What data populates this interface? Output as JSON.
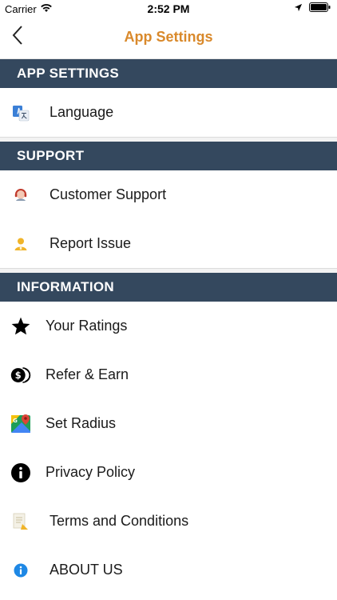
{
  "status_bar": {
    "carrier": "Carrier",
    "time": "2:52 PM"
  },
  "nav": {
    "title": "App Settings",
    "title_color": "#d9892b"
  },
  "sections": [
    {
      "header": "APP SETTINGS",
      "items": [
        {
          "label": "Language",
          "icon": "translate-icon"
        }
      ]
    },
    {
      "header": "SUPPORT",
      "items": [
        {
          "label": "Customer Support",
          "icon": "support-agent-icon"
        },
        {
          "label": "Report Issue",
          "icon": "report-person-icon"
        }
      ]
    },
    {
      "header": "INFORMATION",
      "items": [
        {
          "label": "Your Ratings",
          "icon": "star-icon"
        },
        {
          "label": "Refer & Earn",
          "icon": "coins-icon"
        },
        {
          "label": "Set Radius",
          "icon": "maps-icon"
        },
        {
          "label": "Privacy Policy",
          "icon": "info-filled-icon"
        },
        {
          "label": "Terms and Conditions",
          "icon": "document-icon"
        },
        {
          "label": "ABOUT US",
          "icon": "info-blue-icon"
        }
      ]
    }
  ],
  "colors": {
    "section_header_bg": "#34485e",
    "accent": "#d9892b"
  }
}
